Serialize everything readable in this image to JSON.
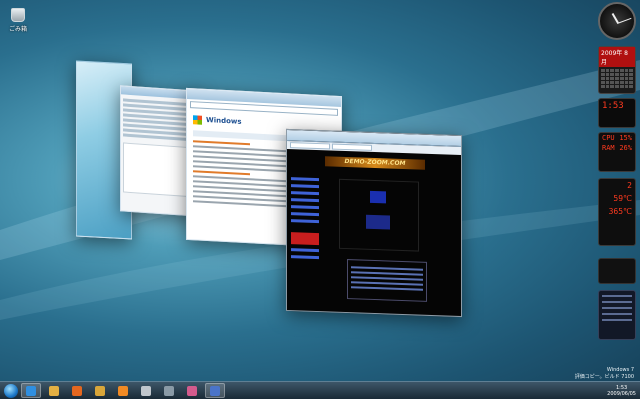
{
  "desktop": {
    "icon_label": "ごみ箱"
  },
  "windows": {
    "ie": {
      "brand": "Windows"
    },
    "front": {
      "site_banner": "DEMO-ZOOM.COM"
    }
  },
  "gadgets": {
    "calendar_header": "2009年 8月",
    "clock_time": "1:53",
    "cpu": [
      {
        "label": "CPU",
        "value": "15%"
      },
      {
        "label": "RAM",
        "value": "26%"
      }
    ],
    "net": [
      {
        "label": "",
        "value": "2"
      },
      {
        "label": "",
        "value": "59℃"
      },
      {
        "label": "",
        "value": "365℃"
      }
    ]
  },
  "watermark": {
    "line1": "Windows 7",
    "line2": "評価コピー。ビルド 7100"
  },
  "taskbar": {
    "time": "1:53",
    "date": "2009/06/05",
    "buttons": [
      {
        "name": "ie-taskbar-button",
        "color": "#2f8fe0",
        "active": true
      },
      {
        "name": "explorer-taskbar-button",
        "color": "#e3b043",
        "active": false
      },
      {
        "name": "firefox-taskbar-button",
        "color": "#e4671f",
        "active": false
      },
      {
        "name": "folder-taskbar-button",
        "color": "#d9a63a",
        "active": false
      },
      {
        "name": "media-player-taskbar-button",
        "color": "#f08a24",
        "active": false
      },
      {
        "name": "settings-taskbar-button",
        "color": "#c0c6cc",
        "active": false
      },
      {
        "name": "app-taskbar-button",
        "color": "#8a9aa6",
        "active": false
      },
      {
        "name": "paint-taskbar-button",
        "color": "#d35b8d",
        "active": false
      },
      {
        "name": "flip3d-taskbar-button",
        "color": "#4a74c9",
        "active": true
      }
    ]
  }
}
